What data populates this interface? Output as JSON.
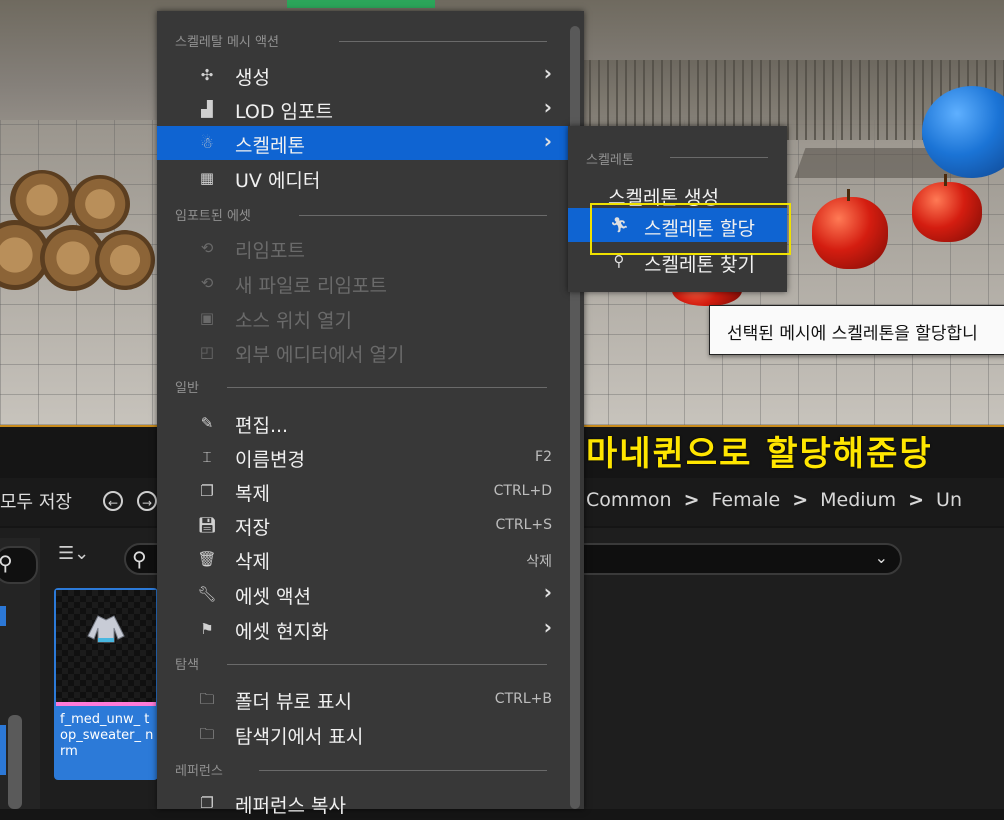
{
  "viewport": {
    "caption": "마네퀸으로 할당해준당"
  },
  "menu": {
    "sections": {
      "skeletal_mesh_actions": "스켈레탈 메시 액션",
      "imported_assets": "임포트된 에셋",
      "general": "일반",
      "browse": "탐색",
      "references": "레퍼런스"
    },
    "items": {
      "generate": "생성",
      "lod_import": "LOD 임포트",
      "skeleton": "스켈레톤",
      "uv_editor": "UV 에디터",
      "reimport": "리임포트",
      "reimport_new_file": "새 파일로 리임포트",
      "open_source_location": "소스 위치 열기",
      "open_external_editor": "외부 에디터에서 열기",
      "edit": "편집...",
      "rename": "이름변경",
      "rename_shortcut": "F2",
      "duplicate": "복제",
      "duplicate_shortcut": "CTRL+D",
      "save": "저장",
      "save_shortcut": "CTRL+S",
      "delete": "삭제",
      "delete_shortcut": "삭제",
      "asset_actions": "에셋 액션",
      "asset_localization": "에셋 현지화",
      "show_in_folder_view": "폴더 뷰로 표시",
      "show_in_folder_view_shortcut": "CTRL+B",
      "show_in_explorer": "탐색기에서 표시",
      "copy_reference": "레퍼런스 복사"
    }
  },
  "submenu": {
    "title": "스켈레톤",
    "create_skeleton": "스켈레톤 생성",
    "assign_skeleton": "스켈레톤 할당",
    "find_skeleton": "스켈레톤 찾기"
  },
  "tooltip": {
    "text": "선택된 메시에 스켈레톤을 할당합니"
  },
  "content_browser": {
    "save_all": "모두 저장",
    "breadcrumb": [
      "Common",
      "Female",
      "Medium",
      "Un"
    ],
    "asset_name": "f_med_unw_ top_sweater_ nrm"
  },
  "colors": {
    "menu_bg": "#383838",
    "highlight": "#0f64d2",
    "caption": "#ffe600",
    "callout_box": "#f0e100"
  }
}
